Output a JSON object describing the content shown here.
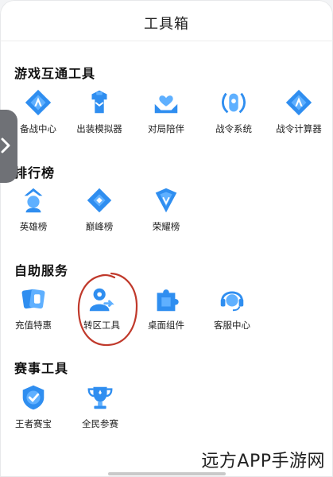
{
  "header": {
    "title": "工具箱"
  },
  "sections": {
    "interop": {
      "title": "游戏互通工具",
      "items": [
        {
          "label": "备战中心",
          "icon": "diamond-a-icon"
        },
        {
          "label": "出装模拟器",
          "icon": "armor-icon"
        },
        {
          "label": "对局陪伴",
          "icon": "hands-heart-icon"
        },
        {
          "label": "战令系统",
          "icon": "war-token-icon"
        },
        {
          "label": "战令计算器",
          "icon": "diamond-a-icon"
        }
      ]
    },
    "rankings": {
      "title": "排行榜",
      "items": [
        {
          "label": "英雄榜",
          "icon": "hero-icon"
        },
        {
          "label": "巅峰榜",
          "icon": "peak-icon"
        },
        {
          "label": "荣耀榜",
          "icon": "glory-shield-icon"
        }
      ]
    },
    "self_service": {
      "title": "自助服务",
      "items": [
        {
          "label": "充值特惠",
          "icon": "cards-icon"
        },
        {
          "label": "转区工具",
          "icon": "user-transfer-icon"
        },
        {
          "label": "桌面组件",
          "icon": "puzzle-icon"
        },
        {
          "label": "客服中心",
          "icon": "headset-icon"
        }
      ]
    },
    "tournament": {
      "title": "赛事工具",
      "items": [
        {
          "label": "王者赛宝",
          "icon": "check-shield-icon"
        },
        {
          "label": "全民参赛",
          "icon": "trophy-icon"
        }
      ]
    }
  },
  "colors": {
    "accent": "#2f8ef0",
    "accent_light": "#5fb0ff",
    "annotation": "#c0392b"
  },
  "watermark": "远方APP手游网"
}
